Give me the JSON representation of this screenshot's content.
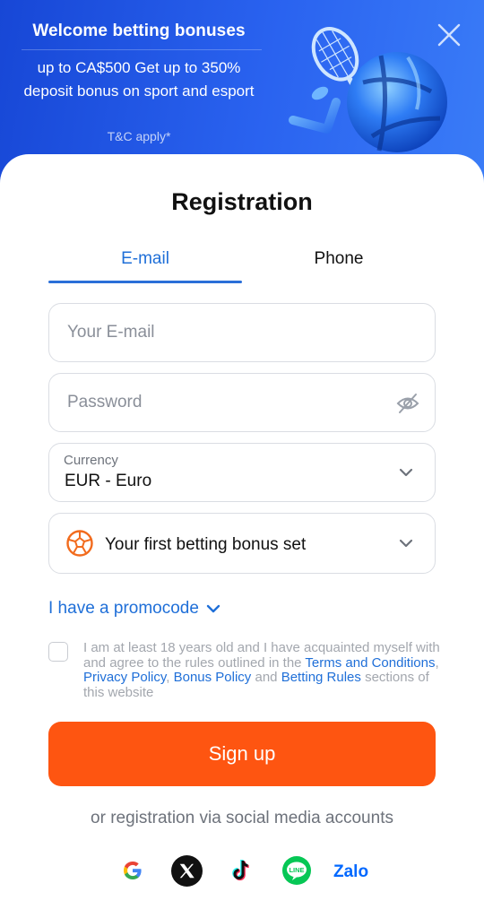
{
  "banner": {
    "title": "Welcome betting bonuses",
    "subtitle": "up to CA$500 Get up to 350% deposit bonus on sport and esport",
    "tc": "T&C apply*"
  },
  "registration": {
    "title": "Registration",
    "tabs": [
      {
        "label": "E-mail",
        "active": true
      },
      {
        "label": "Phone",
        "active": false
      }
    ],
    "email_placeholder": "Your E-mail",
    "password_placeholder": "Password",
    "currency_label": "Currency",
    "currency_value": "EUR - Euro",
    "bonus_label": "Your first betting bonus set",
    "promo_label": "I have a promocode"
  },
  "terms": {
    "text_1": "I am at least 18 years old and I have acquainted myself with and agree to the rules outlined in the ",
    "link_terms": "Terms and Conditions",
    "sep_1": ", ",
    "link_privacy": "Privacy Policy",
    "sep_2": ", ",
    "link_bonus": "Bonus Policy",
    "text_and": " and ",
    "link_betting": "Betting Rules",
    "text_end": " sections of this website"
  },
  "signup_label": "Sign up",
  "social": {
    "caption": "or registration via social media accounts",
    "providers": [
      "google-icon",
      "x-icon",
      "tiktok-icon",
      "line-icon",
      "zalo-icon"
    ],
    "line_text": "LINE",
    "zalo_text": "Zalo"
  },
  "colors": {
    "accent": "#1f6fd8",
    "signup": "#fe5511",
    "banner": "#2a63f0"
  }
}
